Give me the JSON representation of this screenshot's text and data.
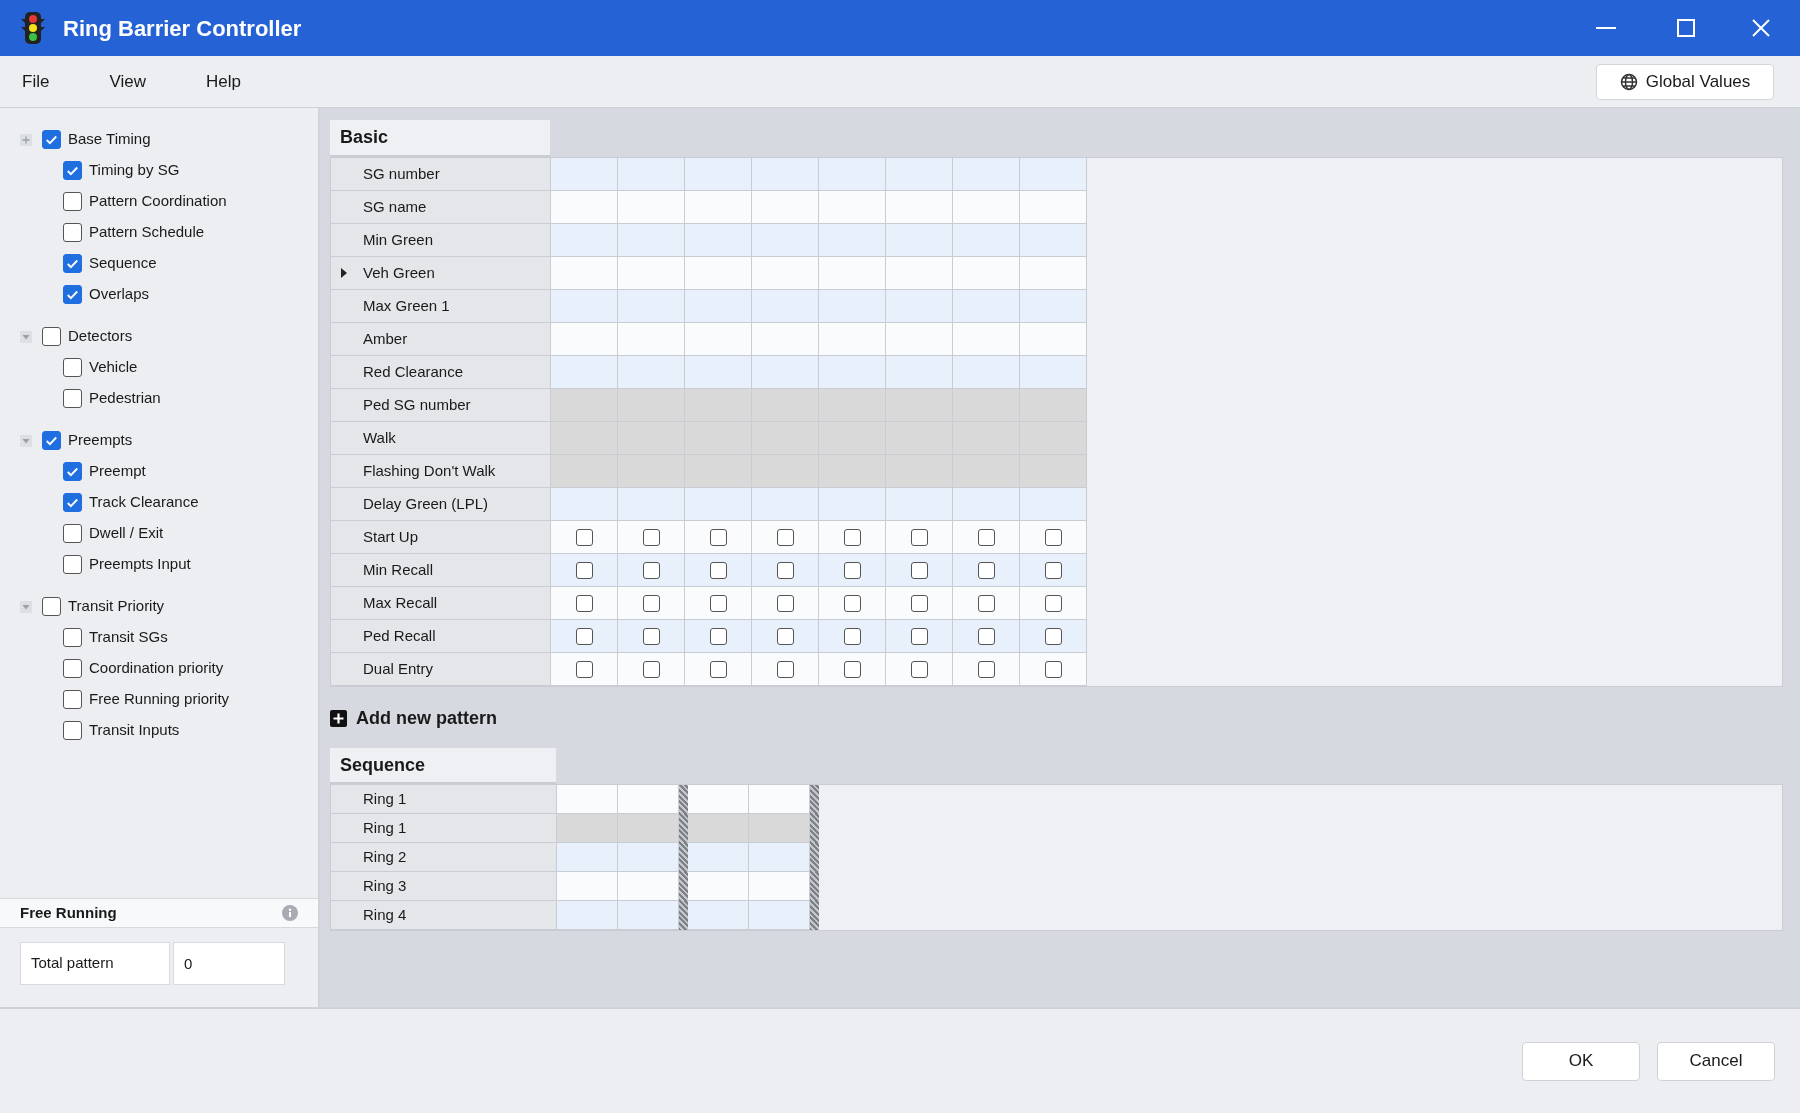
{
  "window": {
    "title": "Ring Barrier Controller"
  },
  "menu": [
    "File",
    "View",
    "Help"
  ],
  "global_button": "Global Values",
  "tree": [
    {
      "label": "Base Timing",
      "checked": true,
      "expanded": false,
      "children": [
        {
          "label": "Timing by SG",
          "checked": true
        },
        {
          "label": "Pattern Coordination",
          "checked": false
        },
        {
          "label": "Pattern Schedule",
          "checked": false
        },
        {
          "label": "Sequence",
          "checked": true
        },
        {
          "label": "Overlaps",
          "checked": true
        }
      ]
    },
    {
      "label": "Detectors",
      "checked": false,
      "expanded": true,
      "children": [
        {
          "label": "Vehicle",
          "checked": false
        },
        {
          "label": "Pedestrian",
          "checked": false
        }
      ]
    },
    {
      "label": "Preempts",
      "checked": true,
      "expanded": true,
      "children": [
        {
          "label": "Preempt",
          "checked": true
        },
        {
          "label": "Track Clearance",
          "checked": true
        },
        {
          "label": "Dwell / Exit",
          "checked": false
        },
        {
          "label": "Preempts Input",
          "checked": false
        }
      ]
    },
    {
      "label": "Transit Priority",
      "checked": false,
      "expanded": true,
      "children": [
        {
          "label": "Transit SGs",
          "checked": false
        },
        {
          "label": "Coordination priority",
          "checked": false
        },
        {
          "label": "Free Running priority",
          "checked": false
        },
        {
          "label": "Transit Inputs",
          "checked": false
        }
      ]
    }
  ],
  "free_running": {
    "title": "Free Running",
    "label": "Total pattern",
    "value": "0"
  },
  "basic": {
    "title": "Basic",
    "rows": [
      {
        "label": "SG number",
        "kind": "input",
        "selected": false
      },
      {
        "label": "SG name",
        "kind": "input",
        "selected": false
      },
      {
        "label": "Min Green",
        "kind": "input",
        "selected": false
      },
      {
        "label": "Veh Green",
        "kind": "input",
        "selected": true
      },
      {
        "label": "Max Green 1",
        "kind": "input",
        "selected": false
      },
      {
        "label": "Amber",
        "kind": "input",
        "selected": false
      },
      {
        "label": "Red Clearance",
        "kind": "input",
        "selected": false
      },
      {
        "label": "Ped SG number",
        "kind": "disabled",
        "selected": false
      },
      {
        "label": "Walk",
        "kind": "disabled",
        "selected": false
      },
      {
        "label": "Flashing Don't Walk",
        "kind": "disabled",
        "selected": false
      },
      {
        "label": "Delay Green (LPL)",
        "kind": "input",
        "selected": false
      },
      {
        "label": "Start Up",
        "kind": "checkbox",
        "selected": false,
        "checks": [
          false,
          false,
          false,
          false,
          false,
          false,
          false,
          false
        ]
      },
      {
        "label": "Min Recall",
        "kind": "checkbox",
        "selected": false,
        "checks": [
          false,
          false,
          false,
          false,
          false,
          false,
          false,
          false
        ]
      },
      {
        "label": "Max Recall",
        "kind": "checkbox",
        "selected": false,
        "checks": [
          false,
          false,
          false,
          false,
          false,
          false,
          false,
          false
        ]
      },
      {
        "label": "Ped Recall",
        "kind": "checkbox",
        "selected": false,
        "checks": [
          false,
          false,
          false,
          false,
          false,
          false,
          false,
          false
        ]
      },
      {
        "label": "Dual Entry",
        "kind": "checkbox",
        "selected": false,
        "checks": [
          false,
          false,
          false,
          false,
          false,
          false,
          false,
          false
        ]
      }
    ]
  },
  "add_pattern": "Add new pattern",
  "sequence": {
    "title": "Sequence",
    "rows": [
      {
        "label": "Ring 1",
        "disabled": false
      },
      {
        "label": "Ring 1",
        "disabled": true
      },
      {
        "label": "Ring 2",
        "disabled": false
      },
      {
        "label": "Ring 3",
        "disabled": false
      },
      {
        "label": "Ring 4",
        "disabled": false
      }
    ]
  },
  "buttons": [
    "OK",
    "Cancel"
  ]
}
